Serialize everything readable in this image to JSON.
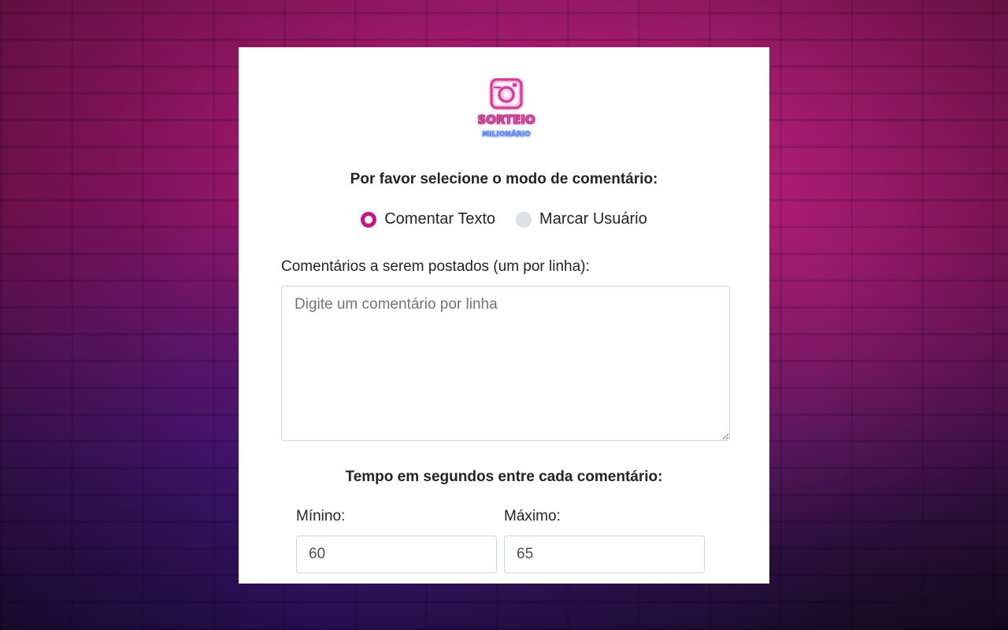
{
  "colors": {
    "accent": "#c2188b",
    "radio_unchecked": "#dee2e6",
    "text": "#212529",
    "placeholder": "#6c757d",
    "input_border": "#ced4da"
  },
  "logo": {
    "icon": "instagram-camera-icon",
    "line1": "SORTEIO",
    "line2": "MILIONÁRIO"
  },
  "mode": {
    "title": "Por favor selecione o modo de comentário:",
    "options": [
      {
        "label": "Comentar Texto",
        "checked": true
      },
      {
        "label": "Marcar Usuário",
        "checked": false
      }
    ]
  },
  "comments": {
    "label": "Comentários a serem postados (um por linha):",
    "placeholder": "Digite um comentário por linha",
    "value": ""
  },
  "timing": {
    "title": "Tempo em segundos entre cada comentário:",
    "min_label": "Mínino:",
    "min_value": "60",
    "max_label": "Máximo:",
    "max_value": "65"
  }
}
